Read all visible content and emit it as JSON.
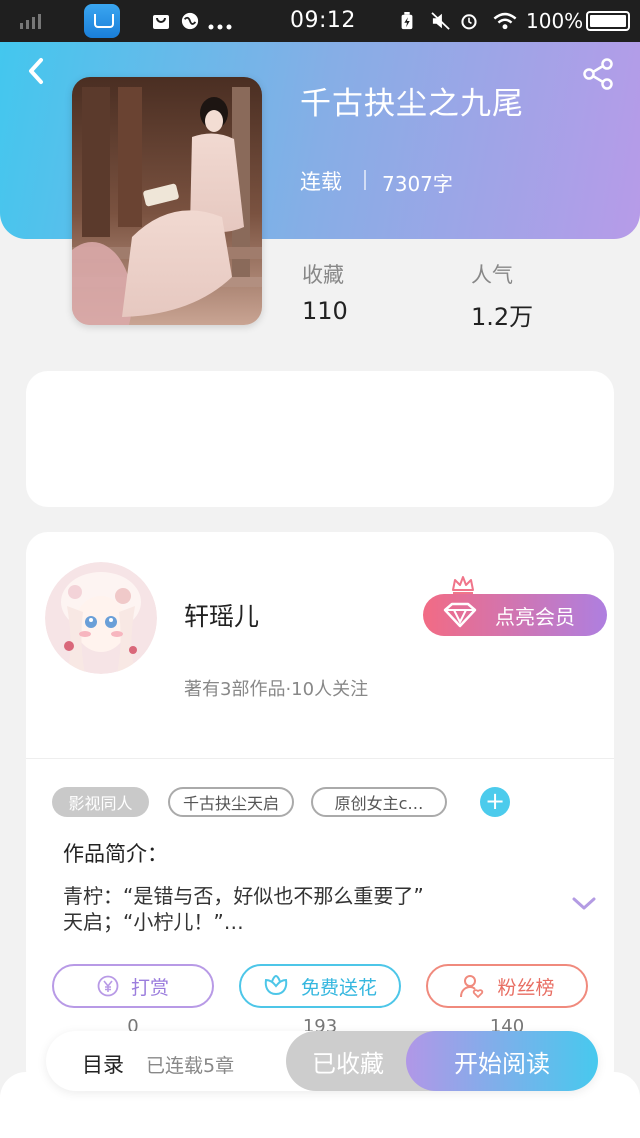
{
  "status_bar": {
    "time": "09:12",
    "battery": "100%"
  },
  "book": {
    "title": "千古抉尘之九尾",
    "status": "连载",
    "word_count": "7307字",
    "stats": [
      {
        "label": "收藏",
        "value": "110"
      },
      {
        "label": "人气",
        "value": "1.2万"
      }
    ]
  },
  "author": {
    "name": "轩瑶儿",
    "meta": "著有3部作品·10人关注",
    "vip_label": "点亮会员"
  },
  "tags": [
    "影视同人",
    "千古抉尘天启",
    "原创女主c…"
  ],
  "intro": {
    "title": "作品简介：",
    "lines": [
      "青柠：“是错与否，好似也不那么重要了”",
      "天启；“小柠儿！”…"
    ]
  },
  "actions": [
    {
      "label": "打赏",
      "count": "0",
      "icon": "yuan-icon"
    },
    {
      "label": "免费送花",
      "count": "193",
      "icon": "flower-icon"
    },
    {
      "label": "粉丝榜",
      "count": "140",
      "icon": "fans-icon"
    }
  ],
  "bottom_bar": {
    "toc_label": "目录",
    "toc_sub": "已连载5章",
    "favorite_label": "已收藏",
    "read_label": "开始阅读"
  }
}
